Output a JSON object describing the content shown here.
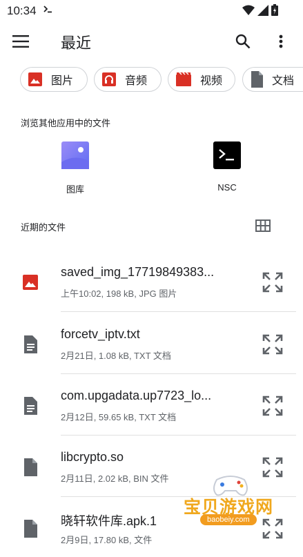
{
  "status_bar": {
    "time": "10:34",
    "term_glyph": ">_"
  },
  "app_bar": {
    "title": "最近"
  },
  "chips": [
    {
      "label": "图片",
      "icon": "image-icon",
      "color": "#d93025"
    },
    {
      "label": "音频",
      "icon": "headphones-icon",
      "color": "#d93025"
    },
    {
      "label": "视频",
      "icon": "video-icon",
      "color": "#d93025"
    },
    {
      "label": "文档",
      "icon": "document-icon",
      "color": "#5f6368"
    }
  ],
  "other_apps": {
    "title": "浏览其他应用中的文件",
    "items": [
      {
        "label": "图库",
        "icon": "gallery-icon"
      },
      {
        "label": "NSC",
        "icon": "terminal-icon",
        "glyph": ">_"
      }
    ]
  },
  "recent_files": {
    "title": "近期的文件",
    "items": [
      {
        "name": "saved_img_17719849383...",
        "meta": "上午10:02, 198 kB, JPG 图片",
        "icon": "image-file-icon"
      },
      {
        "name": "forcetv_iptv.txt",
        "meta": "2月21日, 1.08 kB, TXT 文档",
        "icon": "text-file-icon"
      },
      {
        "name": "com.upgadata.up7723_lo...",
        "meta": "2月12日, 59.65 kB, TXT 文档",
        "icon": "text-file-icon"
      },
      {
        "name": "libcrypto.so",
        "meta": "2月11日, 2.02 kB, BIN 文件",
        "icon": "generic-file-icon"
      },
      {
        "name": "晓轩软件库.apk.1",
        "meta": "2月9日, 17.80 kB, 文件",
        "icon": "generic-file-icon"
      }
    ]
  },
  "watermark": {
    "text": "宝贝游戏网",
    "url": "baobeiy.com"
  },
  "colors": {
    "accent_red": "#d93025",
    "icon_gray": "#5f6368",
    "gallery_purple": "#7c7ff5",
    "watermark_orange": "#f0a81e"
  }
}
